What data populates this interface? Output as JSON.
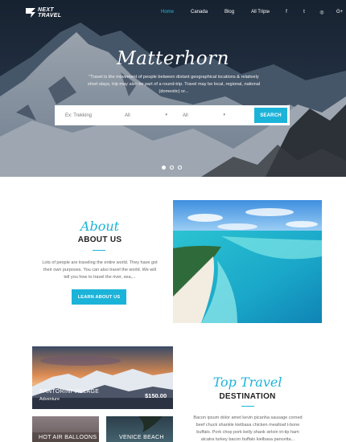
{
  "brand": {
    "line1": "NEXT",
    "line2": "TRAVEL"
  },
  "nav": {
    "items": [
      "Home",
      "Canada",
      "Blog",
      "All Trips"
    ],
    "active": "Home"
  },
  "social": {
    "icons": [
      "search-icon",
      "facebook-icon",
      "twitter-icon",
      "instagram-icon",
      "google-plus-icon"
    ],
    "glyphs": [
      "⌕",
      "f",
      "t",
      "◎",
      "G+"
    ]
  },
  "hero": {
    "title": "Matterhorn",
    "subtitle": "\"Travel is the movement of people between distant geographical locations & relatively short stays, trip may also be part of a round-trip. Travel may be local, regional, national (domestic) or..."
  },
  "search": {
    "keyword_placeholder": "Ex: Trekking",
    "select1_value": "All",
    "select2_value": "All",
    "button_label": "SEARCH"
  },
  "slider": {
    "count": 3,
    "active_index": 0
  },
  "about": {
    "script": "About",
    "title": "ABOUT US",
    "text": "Lots of people are traveling the entire world. They have got their own purposes. You can also travel the world. We will tell you how to travel the river, sea,...",
    "button_label": "LEARN ABOUT US"
  },
  "cards": [
    {
      "name": "SANTORINI VILLAGE",
      "category": "Adventure",
      "price": "$150.00"
    },
    {
      "name": "HOT AIR BALLOONS"
    },
    {
      "name": "VENICE BEACH"
    }
  ],
  "top_travel": {
    "script": "Top Travel",
    "title": "DESTINATION",
    "text": "Bacon ipsum dolor amet kevin picanha sausage corned beef chuck shankle kielbasa chicken meatloaf t-bone buffalo. Pork chop pork belly shank sirloin tri-tip ham alcatra turkey bacon buffalo kielbasa pancetta..."
  },
  "colors": {
    "accent": "#1cb3d9",
    "hero_dark": "#1f2c3d",
    "title": "#222222"
  }
}
